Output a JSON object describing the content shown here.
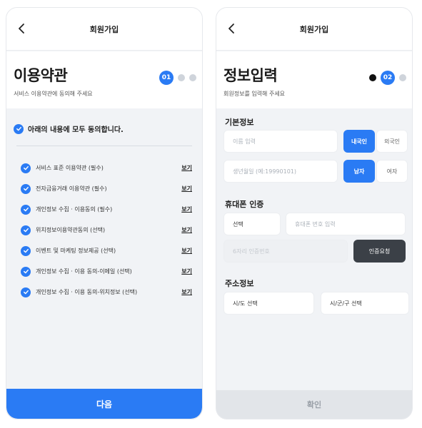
{
  "terms_screen": {
    "header_title": "회원가입",
    "page_title": "이용약관",
    "subtitle": "서비스 이용약관에 동의해 주세요",
    "step_label": "01",
    "all_agree": "아래의 내용에 모두 동의합니다.",
    "items": [
      {
        "label": "서비스 표준 이용약관 (필수)",
        "view": "보기"
      },
      {
        "label": "전자금융거래 이용약관 (필수)",
        "view": "보기"
      },
      {
        "label": "개인정보 수집 · 이용동의 (필수)",
        "view": "보기"
      },
      {
        "label": "위치정보이용약관동의 (선택)",
        "view": "보기"
      },
      {
        "label": "이벤트 및 마케팅 정보제공 (선택)",
        "view": "보기"
      },
      {
        "label": "개인정보 수집 · 이용 동의-이메일 (선택)",
        "view": "보기"
      },
      {
        "label": "개인정보 수집 · 이용 동의-위치정보 (선택)",
        "view": "보기"
      }
    ],
    "next_label": "다음"
  },
  "info_screen": {
    "header_title": "회원가입",
    "page_title": "정보입력",
    "subtitle": "회원정보를 입력해 주세요",
    "step_label": "02",
    "basic_section": "기본정보",
    "name_placeholder": "이름 입력",
    "nationality": {
      "selected": "내국인",
      "other": "외국인"
    },
    "birth_placeholder": "생년월일 (예:19990101)",
    "gender": {
      "selected": "남자",
      "other": "여자"
    },
    "phone_section": "휴대폰 인증",
    "carrier_placeholder": "선택",
    "phone_placeholder": "휴대폰 번호 입력",
    "code_placeholder": "6자리 인증번호",
    "request_label": "인증요청",
    "address_section": "주소정보",
    "province_placeholder": "시/도 선택",
    "city_placeholder": "시/군/구 선택",
    "confirm_label": "확인"
  },
  "colors": {
    "accent": "#2a7bf4",
    "dark_button": "#3b4047",
    "disabled": "#e2e5e9"
  }
}
